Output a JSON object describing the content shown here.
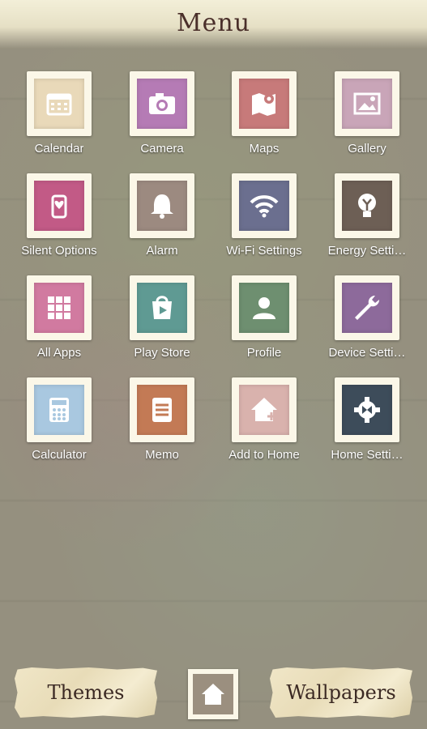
{
  "header": {
    "title": "Menu"
  },
  "apps": [
    {
      "label": "Calendar",
      "icon": "calendar-icon",
      "bg": "#e9d9b9",
      "fg": "#ffffff"
    },
    {
      "label": "Camera",
      "icon": "camera-icon",
      "bg": "#b57bb5",
      "fg": "#ffffff"
    },
    {
      "label": "Maps",
      "icon": "maps-icon",
      "bg": "#c77a7a",
      "fg": "#ffffff"
    },
    {
      "label": "Gallery",
      "icon": "gallery-icon",
      "bg": "#c9a5b8",
      "fg": "#ffffff"
    },
    {
      "label": "Silent Options",
      "icon": "silent-options-icon",
      "bg": "#c25a86",
      "fg": "#ffffff"
    },
    {
      "label": "Alarm",
      "icon": "alarm-icon",
      "bg": "#9c8a80",
      "fg": "#ffffff"
    },
    {
      "label": "Wi-Fi Settings",
      "icon": "wifi-icon",
      "bg": "#6b6f8f",
      "fg": "#ffffff"
    },
    {
      "label": "Energy Setti…",
      "icon": "energy-icon",
      "bg": "#6d5f55",
      "fg": "#ffffff"
    },
    {
      "label": "All Apps",
      "icon": "all-apps-icon",
      "bg": "#d17aa0",
      "fg": "#ffffff"
    },
    {
      "label": "Play Store",
      "icon": "play-store-icon",
      "bg": "#5f9a93",
      "fg": "#ffffff"
    },
    {
      "label": "Profile",
      "icon": "profile-icon",
      "bg": "#6e8f70",
      "fg": "#ffffff"
    },
    {
      "label": "Device Setti…",
      "icon": "wrench-icon",
      "bg": "#8d6a9b",
      "fg": "#ffffff"
    },
    {
      "label": "Calculator",
      "icon": "calculator-icon",
      "bg": "#a9c8e0",
      "fg": "#ffffff"
    },
    {
      "label": "Memo",
      "icon": "memo-icon",
      "bg": "#c37a55",
      "fg": "#ffffff"
    },
    {
      "label": "Add to Home",
      "icon": "add-to-home-icon",
      "bg": "#d9b2ad",
      "fg": "#ffffff"
    },
    {
      "label": "Home Setti…",
      "icon": "home-settings-icon",
      "bg": "#3d4c5a",
      "fg": "#ffffff"
    }
  ],
  "bottom": {
    "themes_label": "Themes",
    "wallpapers_label": "Wallpapers",
    "home_icon": "home-icon"
  }
}
